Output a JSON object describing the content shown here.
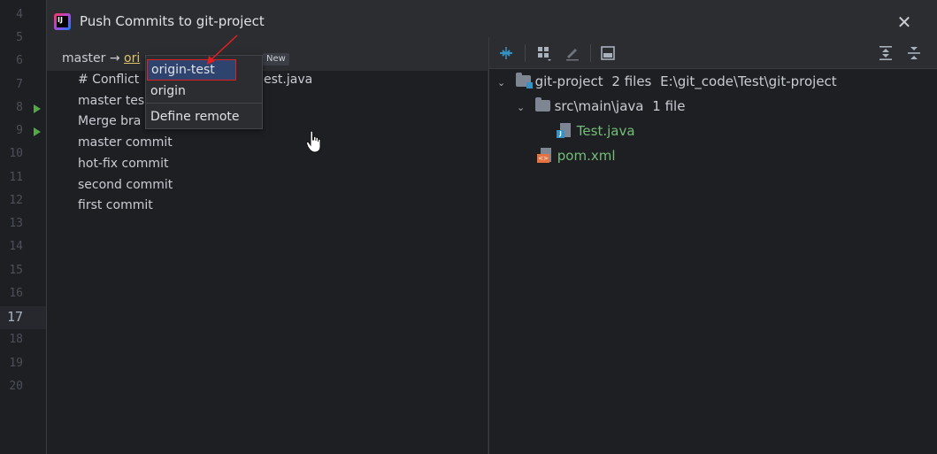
{
  "editor": {
    "line_numbers": [
      "4",
      "5",
      "6",
      "7",
      "8",
      "9",
      "10",
      "11",
      "12",
      "13",
      "14",
      "15",
      "16",
      "17",
      "18",
      "19",
      "20"
    ],
    "active_line": "17"
  },
  "dialog": {
    "title": "Push Commits to git-project",
    "app_logo_text": "IJ",
    "close_glyph": "✕"
  },
  "branch": {
    "local": "master",
    "arrow": "→",
    "remote_prefix": "ori",
    "new_badge": "New"
  },
  "commits": [
    {
      "label": "# Conflict",
      "tail": "est.java"
    },
    {
      "label": "master tes",
      "tail": ""
    },
    {
      "label": "Merge bra",
      "tail": ""
    },
    {
      "label": "master commit",
      "tail": ""
    },
    {
      "label": "hot-fix commit",
      "tail": ""
    },
    {
      "label": "second commit",
      "tail": ""
    },
    {
      "label": "first commit",
      "tail": ""
    }
  ],
  "remote_popup": {
    "items": [
      "origin-test",
      "origin",
      "Define remote"
    ],
    "highlighted": "origin-test"
  },
  "toolbar": {
    "icons": [
      "collapse-arrows-icon",
      "group-by-icon",
      "edit-icon",
      "save-icon",
      "expand-all-icon",
      "collapse-all-icon"
    ]
  },
  "file_tree": {
    "root": {
      "name": "git-project",
      "count": "2 files",
      "path": "E:\\git_code\\Test\\git-project"
    },
    "folder": {
      "name": "src\\main\\java",
      "count": "1 file"
    },
    "files": [
      "Test.java",
      "pom.xml"
    ]
  },
  "colors": {
    "accent": "#3592c4",
    "file_added": "#73bd79",
    "remote_link": "#e0c46c",
    "highlight_border": "#e02020"
  }
}
